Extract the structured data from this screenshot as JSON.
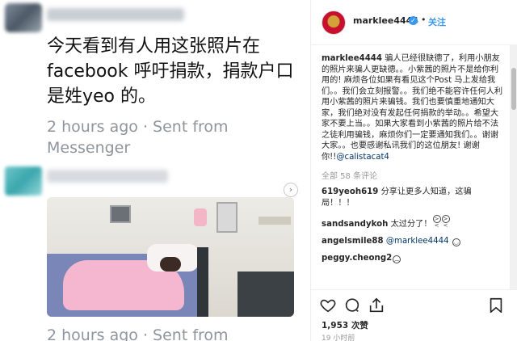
{
  "left": {
    "message_text": "今天看到有人用这张照片在facebook 呼吁捐款，捐款户口是姓yeo 的。",
    "time_1": "2 hours ago · Sent from Messenger",
    "time_2": "2 hours ago · Sent from",
    "next_icon": "chevron-right-icon"
  },
  "post": {
    "username": "marklee4444",
    "verified_icon": "verified-badge-icon",
    "dot": "•",
    "follow_label": "关注",
    "caption_user": "marklee4444",
    "caption_text": " 骗人已经很缺德了，利用小朋友的照片来骗人更缺德。。小紫茜的照片不是给你利用的! 麻烦各位如果有看见这个Post 马上发给我们。。我们会立刻报警。。我们绝不能容许任何人利用小紫茜的照片来骗钱。我们也要慎重地通知大家，我们绝对没有发起任何捐款的举动。。希望大家不要上当。。如果大家看到小紫茜的照片给不法之徒利用骗钱，麻烦你们一定要通知我们。。谢谢大家。。也要感谢私讯我们的这位朋友! 谢谢你!!",
    "caption_mention": "@calistacat4",
    "view_all": "全部 58 条评论",
    "comments": [
      {
        "user": "619yeoh619",
        "text": " 分享让更多人知道，这骗局！！！",
        "mention": "",
        "emoji": ""
      },
      {
        "user": "sandsandykoh",
        "text": " 太过分了！",
        "mention": "",
        "emoji": "angry-face-emoji"
      },
      {
        "user": "angelsmile88",
        "text": " ",
        "mention": "@marklee4444",
        "emoji": "smile-emoji"
      },
      {
        "user": "peggy.cheong2",
        "text": "",
        "mention": "",
        "emoji": "sad-face-emoji"
      }
    ],
    "likes": "1,953 次赞",
    "time_ago": "19 小时前",
    "colors": {
      "link": "#3897f0",
      "mention": "#003569",
      "text": "#262626",
      "muted": "#999999"
    }
  }
}
